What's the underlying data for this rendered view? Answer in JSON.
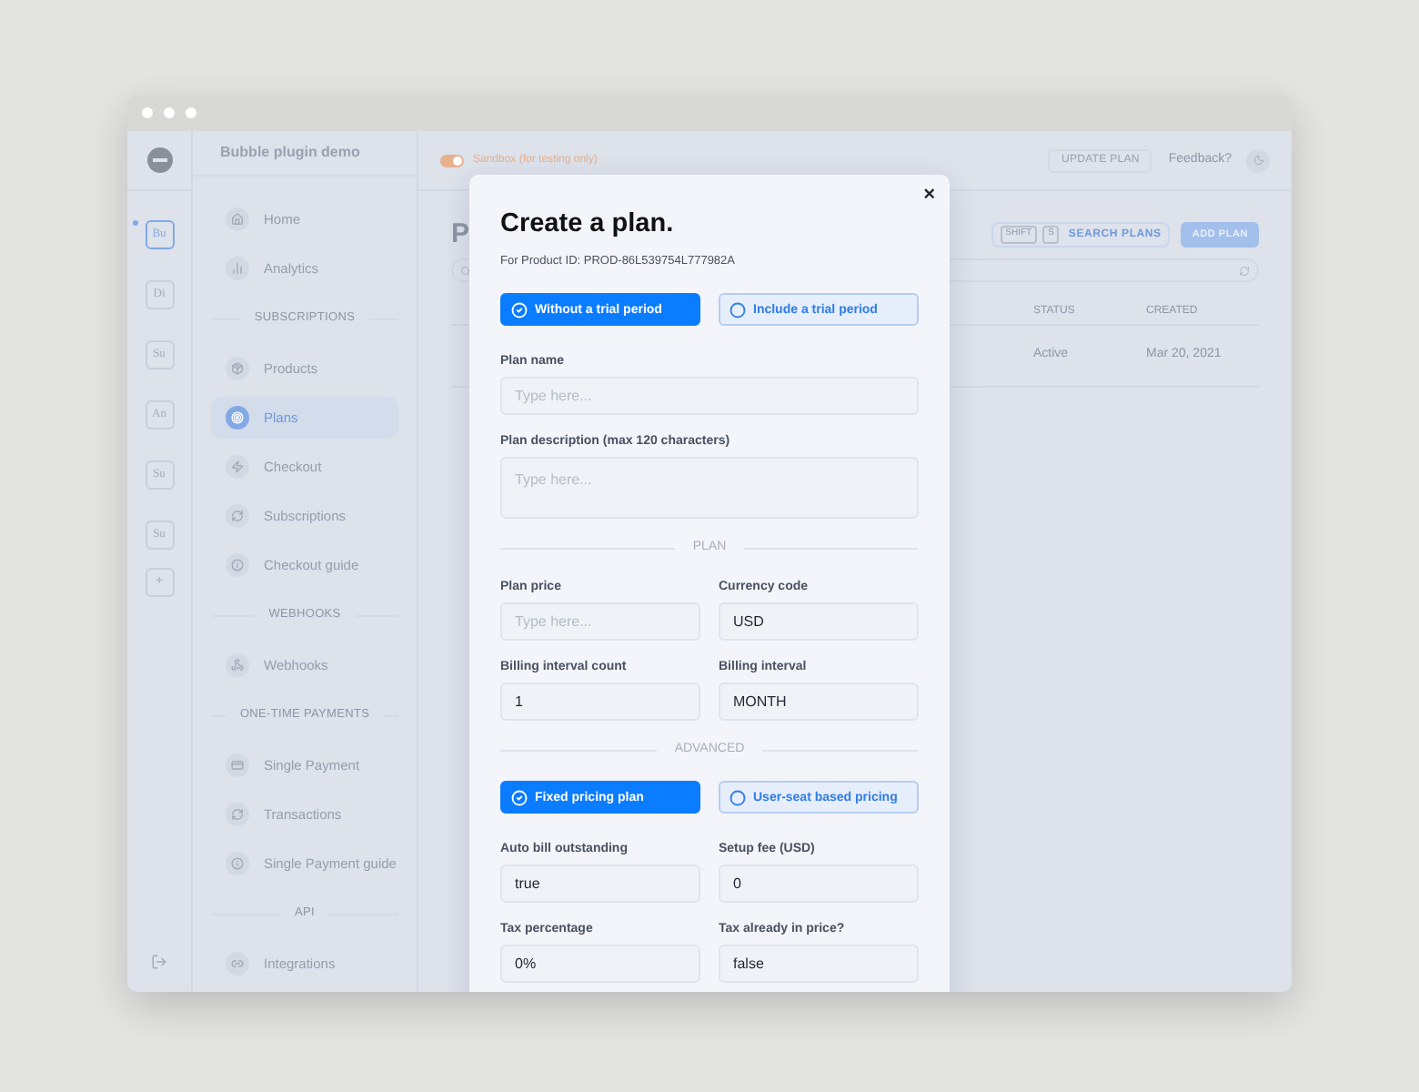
{
  "app": {
    "name": "Bubble plugin demo"
  },
  "workspaces": [
    {
      "label": "Bu",
      "selected": true
    },
    {
      "label": "Di",
      "selected": false
    },
    {
      "label": "Su",
      "selected": false
    },
    {
      "label": "An",
      "selected": false
    },
    {
      "label": "Su",
      "selected": false
    },
    {
      "label": "Su",
      "selected": false
    }
  ],
  "add_workspace": "+",
  "sidebar": {
    "items": [
      {
        "kind": "item",
        "label": "Home",
        "selected": false
      },
      {
        "kind": "item",
        "label": "Analytics",
        "selected": false
      },
      {
        "kind": "section",
        "label": "SUBSCRIPTIONS"
      },
      {
        "kind": "item",
        "label": "Products",
        "selected": false
      },
      {
        "kind": "item",
        "label": "Plans",
        "selected": true
      },
      {
        "kind": "item",
        "label": "Checkout",
        "selected": false
      },
      {
        "kind": "item",
        "label": "Subscriptions",
        "selected": false
      },
      {
        "kind": "item",
        "label": "Checkout guide",
        "selected": false
      },
      {
        "kind": "section",
        "label": "WEBHOOKS"
      },
      {
        "kind": "item",
        "label": "Webhooks",
        "selected": false
      },
      {
        "kind": "section",
        "label": "ONE-TIME PAYMENTS"
      },
      {
        "kind": "item",
        "label": "Single Payment",
        "selected": false
      },
      {
        "kind": "item",
        "label": "Transactions",
        "selected": false
      },
      {
        "kind": "item",
        "label": "Single Payment guide",
        "selected": false
      },
      {
        "kind": "section",
        "label": "API"
      },
      {
        "kind": "item",
        "label": "Integrations",
        "selected": false
      }
    ]
  },
  "topbar": {
    "sandbox": {
      "label": "Sandbox (for testing only)",
      "on": true
    },
    "update_button": "UPDATE PLAN",
    "feedback": "Feedback?"
  },
  "page": {
    "title": "P",
    "search": {
      "keys": [
        "SHIFT",
        "S"
      ],
      "label": "SEARCH PLANS"
    },
    "add_button": "ADD PLAN",
    "table": {
      "columns": [
        "STATUS",
        "CREATED"
      ],
      "rows": [
        [
          "Active",
          "Mar 20, 2021"
        ]
      ]
    }
  },
  "modal": {
    "title": "Create a plan.",
    "subtitle": "For Product ID: PROD-86L539754L777982A",
    "close": "×",
    "blocks": [
      {
        "kind": "choice",
        "options": [
          {
            "label": "Without a trial period",
            "selected": true
          },
          {
            "label": "Include a trial period",
            "selected": false
          }
        ]
      },
      {
        "kind": "field",
        "label": "Plan name",
        "placeholder": "Type here..."
      },
      {
        "kind": "textarea",
        "label": "Plan description (max 120 characters)",
        "placeholder": "Type here..."
      },
      {
        "kind": "divider",
        "label": "PLAN"
      },
      {
        "kind": "pair",
        "fields": [
          {
            "label": "Plan price",
            "placeholder": "Type here..."
          },
          {
            "label": "Currency code",
            "value": "USD"
          }
        ]
      },
      {
        "kind": "pair",
        "fields": [
          {
            "label": "Billing interval count",
            "value": "1"
          },
          {
            "label": "Billing interval",
            "value": "MONTH"
          }
        ]
      },
      {
        "kind": "divider",
        "label": "ADVANCED"
      },
      {
        "kind": "choice",
        "options": [
          {
            "label": "Fixed pricing plan",
            "selected": true
          },
          {
            "label": "User-seat based pricing",
            "selected": false
          }
        ]
      },
      {
        "kind": "pair",
        "fields": [
          {
            "label": "Auto bill outstanding",
            "value": "true"
          },
          {
            "label": "Setup fee (USD)",
            "value": "0"
          }
        ]
      },
      {
        "kind": "pair",
        "fields": [
          {
            "label": "Tax percentage",
            "value": "0%"
          },
          {
            "label": "Tax already in price?",
            "value": "false"
          }
        ]
      }
    ]
  }
}
